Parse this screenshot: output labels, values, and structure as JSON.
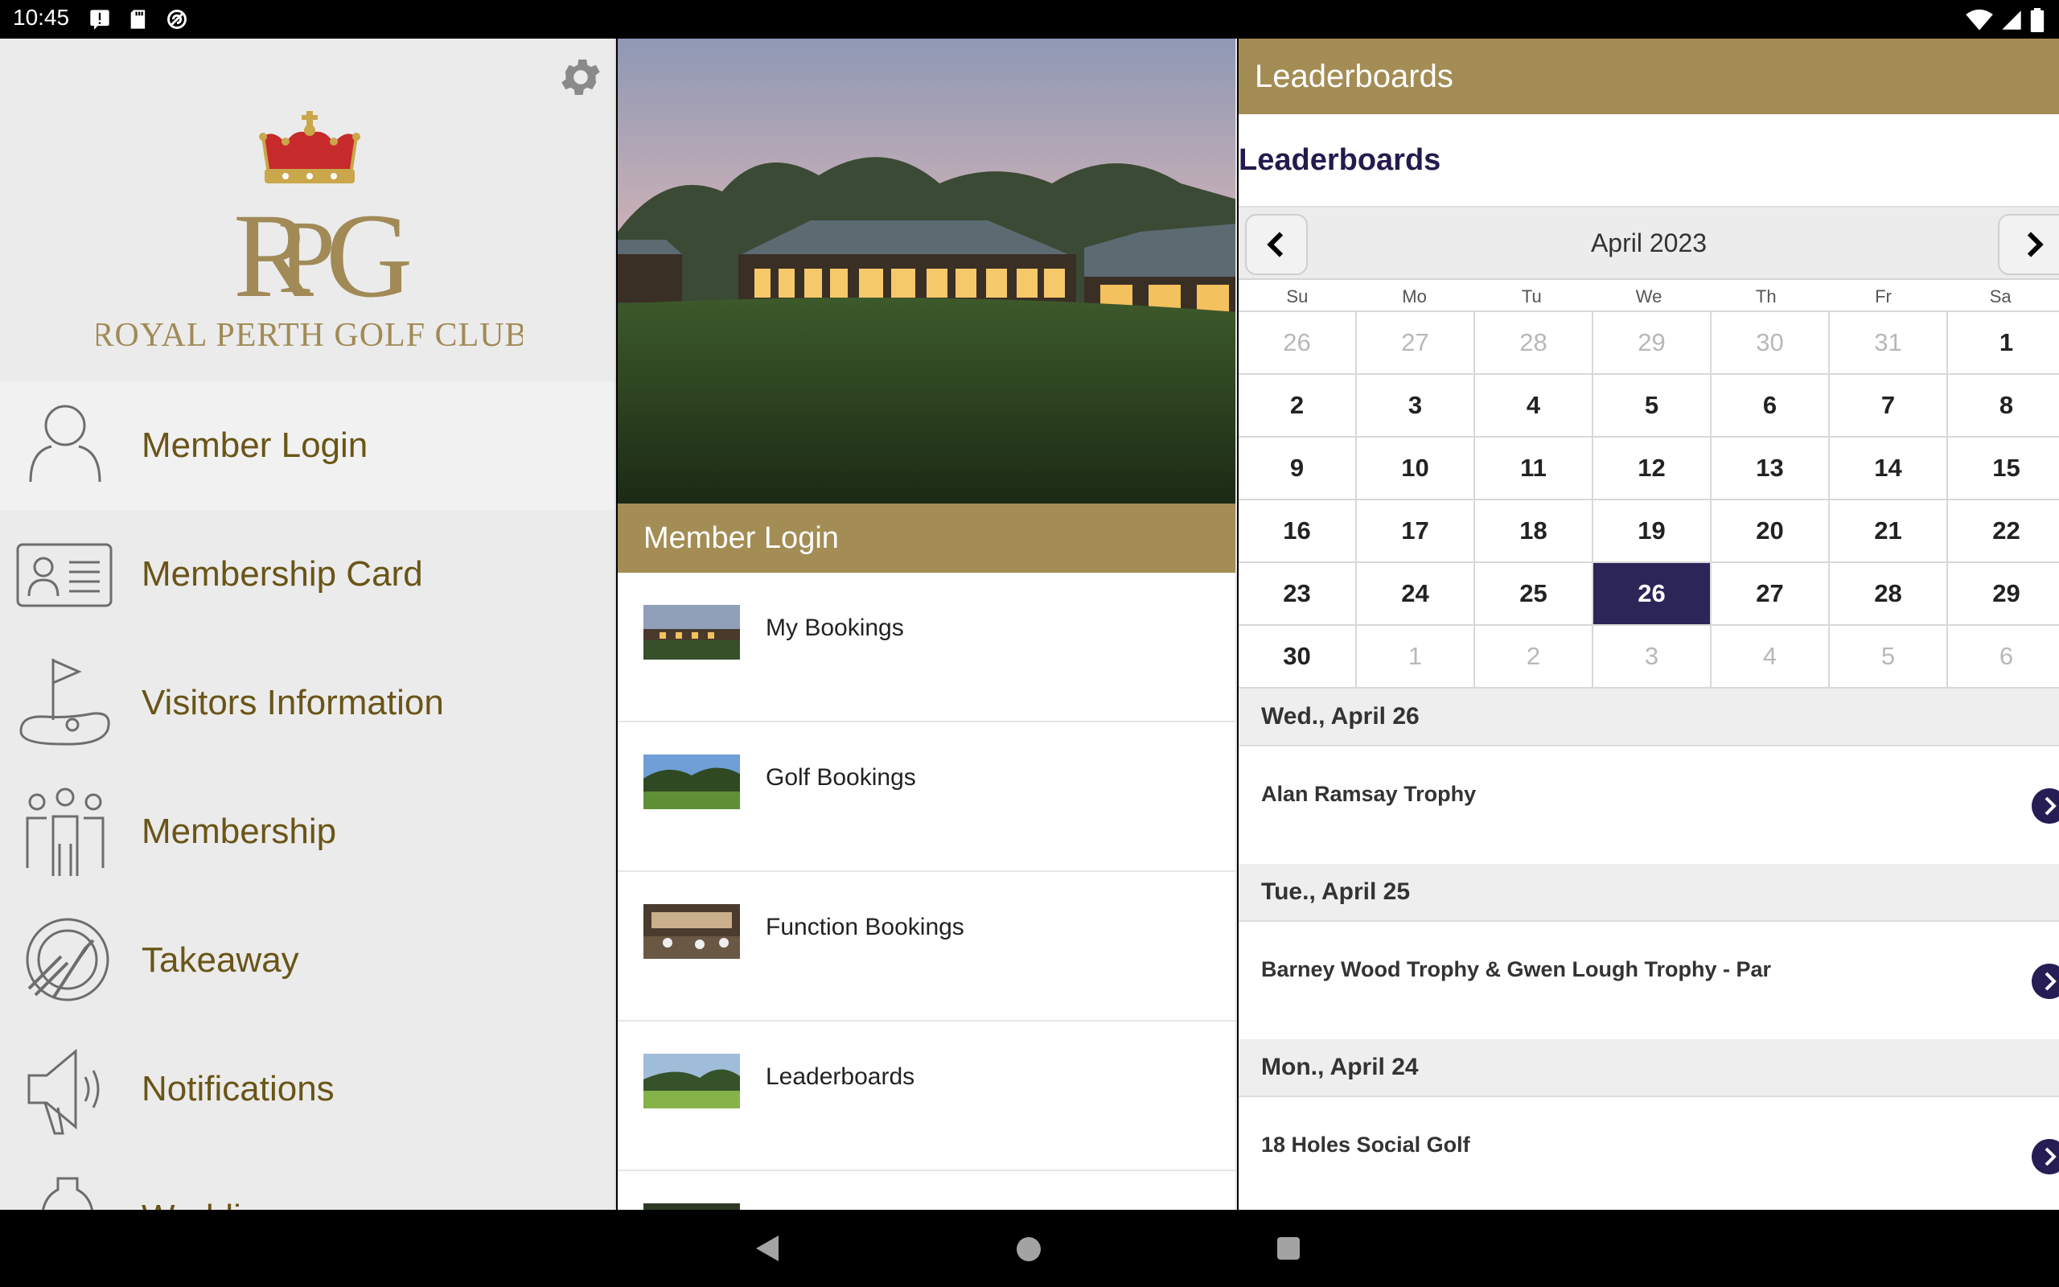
{
  "status_bar": {
    "time": "10:45"
  },
  "drawer": {
    "club_name": "Royal Perth Golf Club",
    "items": [
      {
        "label": "Member Login",
        "icon": "person-icon"
      },
      {
        "label": "Membership Card",
        "icon": "id-card-icon"
      },
      {
        "label": "Visitors Information",
        "icon": "golf-flag-icon"
      },
      {
        "label": "Membership",
        "icon": "group-icon"
      },
      {
        "label": "Takeaway",
        "icon": "plate-cutlery-icon"
      },
      {
        "label": "Notifications",
        "icon": "megaphone-icon"
      },
      {
        "label": "Weddi…",
        "icon": "bell-icon"
      }
    ]
  },
  "middle": {
    "section_title": "Member Login",
    "items": [
      {
        "label": "My Bookings"
      },
      {
        "label": "Golf Bookings"
      },
      {
        "label": "Function Bookings"
      },
      {
        "label": "Leaderboards"
      }
    ]
  },
  "right": {
    "header": "Leaderboards",
    "page_title": "Leaderboards",
    "calendar": {
      "month_label": "April 2023",
      "weekdays": [
        "Su",
        "Mo",
        "Tu",
        "We",
        "Th",
        "Fr",
        "Sa"
      ],
      "days": [
        {
          "d": "26",
          "other": true
        },
        {
          "d": "27",
          "other": true
        },
        {
          "d": "28",
          "other": true
        },
        {
          "d": "29",
          "other": true
        },
        {
          "d": "30",
          "other": true
        },
        {
          "d": "31",
          "other": true
        },
        {
          "d": "1"
        },
        {
          "d": "2"
        },
        {
          "d": "3"
        },
        {
          "d": "4"
        },
        {
          "d": "5"
        },
        {
          "d": "6"
        },
        {
          "d": "7"
        },
        {
          "d": "8"
        },
        {
          "d": "9"
        },
        {
          "d": "10"
        },
        {
          "d": "11"
        },
        {
          "d": "12"
        },
        {
          "d": "13"
        },
        {
          "d": "14"
        },
        {
          "d": "15"
        },
        {
          "d": "16"
        },
        {
          "d": "17"
        },
        {
          "d": "18"
        },
        {
          "d": "19"
        },
        {
          "d": "20"
        },
        {
          "d": "21"
        },
        {
          "d": "22"
        },
        {
          "d": "23"
        },
        {
          "d": "24"
        },
        {
          "d": "25"
        },
        {
          "d": "26",
          "selected": true
        },
        {
          "d": "27"
        },
        {
          "d": "28"
        },
        {
          "d": "29"
        },
        {
          "d": "30"
        },
        {
          "d": "1",
          "other": true
        },
        {
          "d": "2",
          "other": true
        },
        {
          "d": "3",
          "other": true
        },
        {
          "d": "4",
          "other": true
        },
        {
          "d": "5",
          "other": true
        },
        {
          "d": "6",
          "other": true
        }
      ]
    },
    "events": [
      {
        "date": "Wed., April 26",
        "name": "Alan Ramsay Trophy"
      },
      {
        "date": "Tue., April 25",
        "name": "Barney Wood Trophy & Gwen Lough Trophy - Par"
      },
      {
        "date": "Mon., April 24",
        "name": "18 Holes Social Golf"
      }
    ]
  },
  "colors": {
    "gold": "#a48c55",
    "navy": "#261d55",
    "label_gold": "#6a5517"
  }
}
